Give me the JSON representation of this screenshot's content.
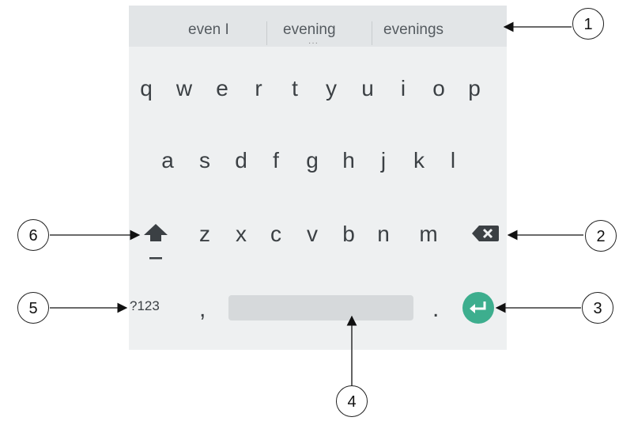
{
  "keyboard": {
    "suggestions": [
      "even I",
      "evening",
      "evenings"
    ],
    "suggestion_more": "···",
    "row1": [
      "q",
      "w",
      "e",
      "r",
      "t",
      "y",
      "u",
      "i",
      "o",
      "p"
    ],
    "row2": [
      "a",
      "s",
      "d",
      "f",
      "g",
      "h",
      "j",
      "k",
      "l"
    ],
    "row3": [
      "z",
      "x",
      "c",
      "v",
      "b",
      "n",
      "m"
    ],
    "symbols_label": "?123",
    "comma": ",",
    "period": ".",
    "shift_icon": "shift-arrow-icon",
    "backspace_icon": "backspace-icon",
    "enter_icon": "enter-return-icon",
    "accent_color": "#3dae8e"
  },
  "callouts": [
    "1",
    "2",
    "3",
    "4",
    "5",
    "6"
  ]
}
